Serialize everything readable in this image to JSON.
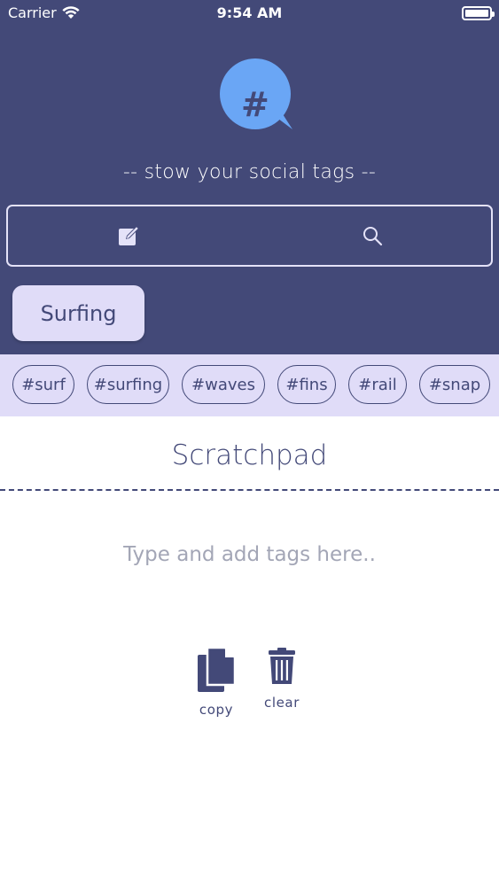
{
  "status_bar": {
    "carrier": "Carrier",
    "time": "9:54 AM"
  },
  "logo": {
    "glyph": "#"
  },
  "tagline": "-- stow your social tags --",
  "search": {
    "left_icon": "edit-icon",
    "right_icon": "search-icon"
  },
  "category": {
    "label": "Surfing"
  },
  "tags": [
    "#surf",
    "#surfing",
    "#waves",
    "#fins",
    "#rail",
    "#snap"
  ],
  "scratchpad": {
    "title": "Scratchpad",
    "placeholder": "Type and add tags here..",
    "copy_label": "copy",
    "clear_label": "clear"
  },
  "colors": {
    "header_bg": "#434978",
    "accent_light": "#e0dcf8",
    "logo_bubble": "#6aa6f5",
    "text_dark": "#434978",
    "placeholder": "#a3a6b6"
  }
}
